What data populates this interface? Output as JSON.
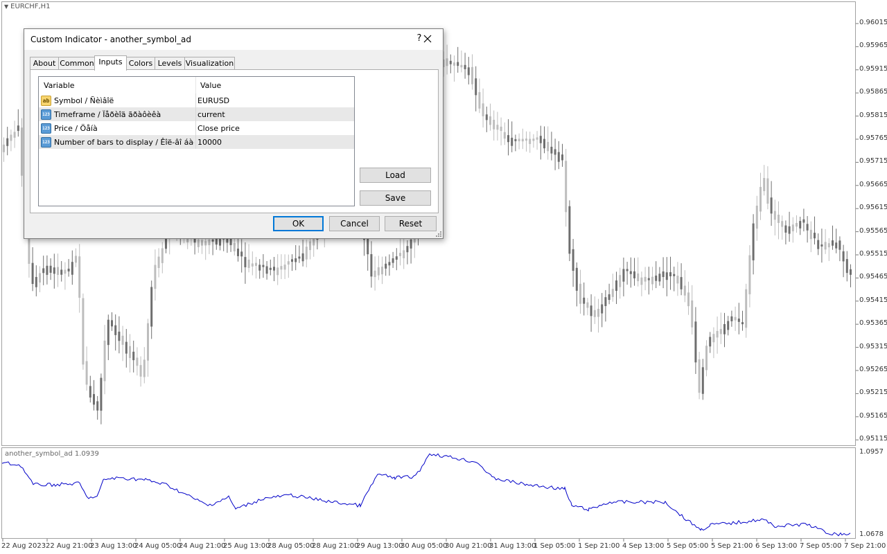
{
  "chart": {
    "symbol_label": "EURCHF,H1",
    "price_axis": [
      "0.96015",
      "0.95965",
      "0.95915",
      "0.95865",
      "0.95815",
      "0.95765",
      "0.95715",
      "0.95665",
      "0.95615",
      "0.95565",
      "0.95515",
      "0.95465",
      "0.95415",
      "0.95365",
      "0.95315",
      "0.95265",
      "0.95215",
      "0.95165",
      "0.95115"
    ],
    "indicator_label": "another_symbol_ad 1.0939",
    "indicator_axis": [
      "1.0957",
      "1.0678"
    ],
    "time_axis": [
      "22 Aug 2023",
      "22 Aug 21:00",
      "23 Aug 13:00",
      "24 Aug 05:00",
      "24 Aug 21:00",
      "25 Aug 13:00",
      "28 Aug 05:00",
      "28 Aug 21:00",
      "29 Aug 13:00",
      "30 Aug 05:00",
      "30 Aug 21:00",
      "31 Aug 13:00",
      "1 Sep 05:00",
      "1 Sep 21:00",
      "4 Sep 13:00",
      "5 Sep 05:00",
      "5 Sep 21:00",
      "6 Sep 13:00",
      "7 Sep 05:00",
      "7 Sep 21:00"
    ],
    "colors": {
      "candle_up": "#bdbdbd",
      "candle_down": "#6e6e6e",
      "indicator_line": "#0000c8",
      "grid_border": "#a0a0a0"
    }
  },
  "dialog": {
    "title": "Custom Indicator - another_symbol_ad",
    "help": "?",
    "close_icon": "close-icon",
    "tabs": [
      {
        "label": "About",
        "active": false
      },
      {
        "label": "Common",
        "active": false
      },
      {
        "label": "Inputs",
        "active": true
      },
      {
        "label": "Colors",
        "active": false
      },
      {
        "label": "Levels",
        "active": false
      },
      {
        "label": "Visualization",
        "active": false
      }
    ],
    "grid": {
      "col_variable": "Variable",
      "col_value": "Value",
      "rows": [
        {
          "icon": "ab",
          "name": "Symbol / Ñèìâîë",
          "value": "EURUSD"
        },
        {
          "icon": "123",
          "name": "Timeframe / Ïåðèîä ãðàôèêà",
          "value": "current"
        },
        {
          "icon": "123",
          "name": "Price / Öåíà",
          "value": "Close price"
        },
        {
          "icon": "123",
          "name": "Number of bars to display / Êîë-âî áàðîâ...",
          "value": "10000"
        }
      ]
    },
    "buttons": {
      "load": "Load",
      "save": "Save",
      "ok": "OK",
      "cancel": "Cancel",
      "reset": "Reset"
    }
  }
}
